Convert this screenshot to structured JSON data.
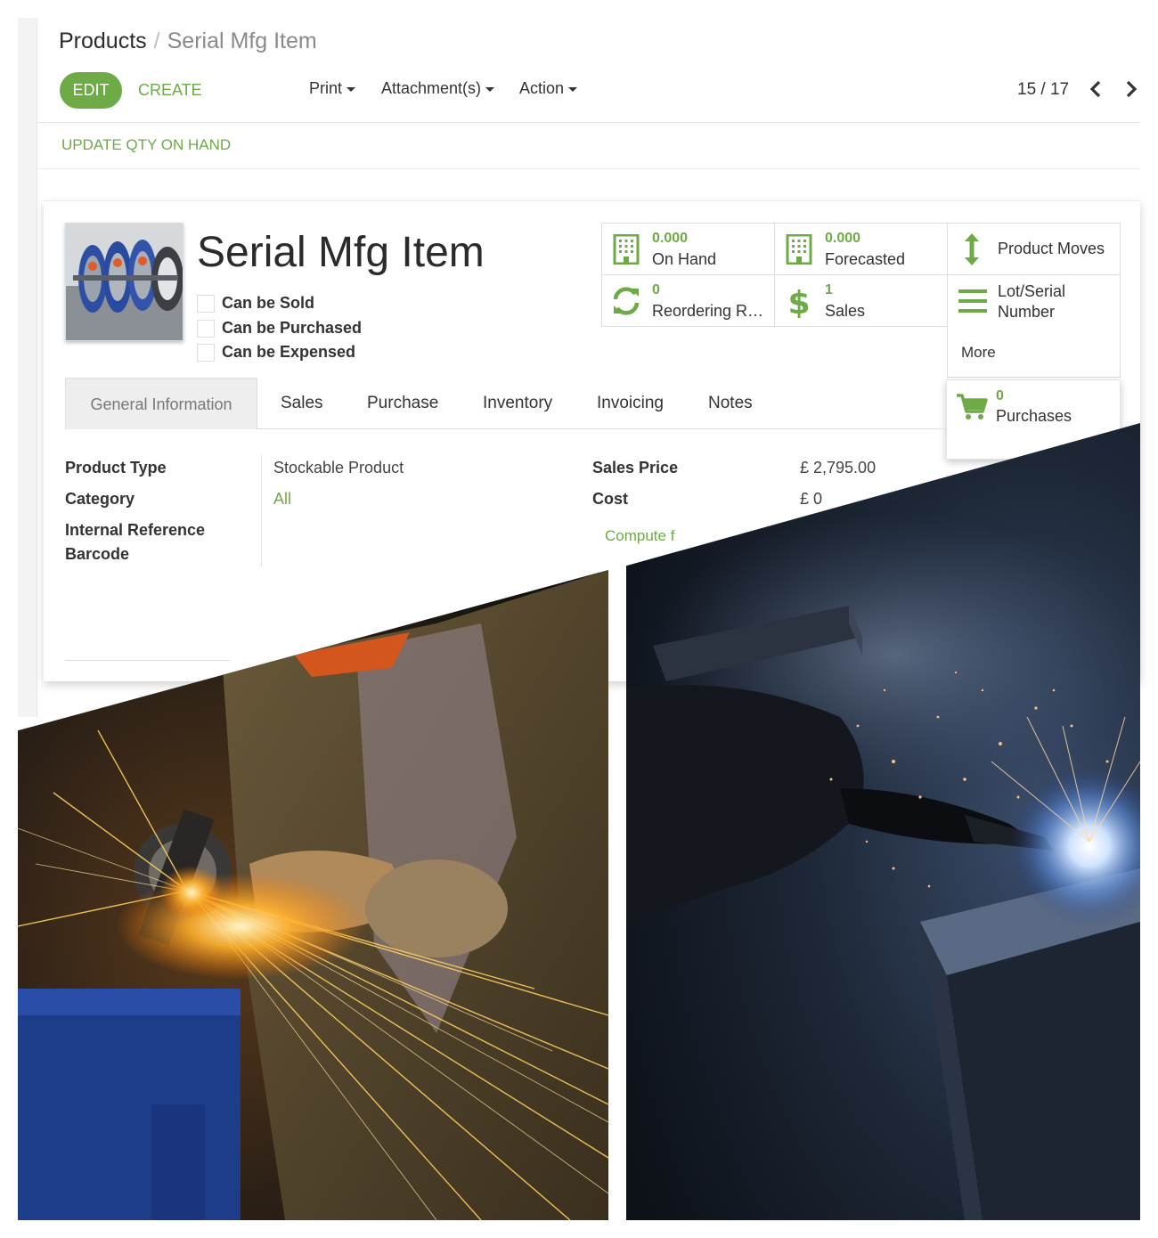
{
  "breadcrumb": {
    "root": "Products",
    "separator": "/",
    "current": "Serial Mfg Item"
  },
  "toolbar": {
    "edit_label": "EDIT",
    "create_label": "CREATE",
    "print_label": "Print",
    "attachments_label": "Attachment(s)",
    "action_label": "Action",
    "pager": "15 / 17"
  },
  "status": {
    "update_qty_label": "UPDATE QTY ON HAND"
  },
  "product": {
    "name": "Serial Mfg Item",
    "checks": [
      {
        "label": "Can be Sold",
        "checked": false
      },
      {
        "label": "Can be Purchased",
        "checked": false
      },
      {
        "label": "Can be Expensed",
        "checked": false
      }
    ]
  },
  "smart_buttons": {
    "on_hand": {
      "value": "0.000",
      "label": "On Hand",
      "icon": "building-icon"
    },
    "forecasted": {
      "value": "0.000",
      "label": "Forecasted",
      "icon": "building-icon"
    },
    "product_moves": {
      "label": "Product Moves",
      "icon": "up-down-arrow-icon"
    },
    "reordering": {
      "value": "0",
      "label": "Reordering R…",
      "icon": "refresh-icon"
    },
    "sales": {
      "value": "1",
      "label": "Sales",
      "icon": "dollar-icon"
    },
    "lot_serial": {
      "label_line1": "Lot/Serial",
      "label_line2": "Number",
      "icon": "list-icon"
    },
    "more_label": "More",
    "purchases": {
      "value": "0",
      "label": "Purchases",
      "icon": "cart-icon"
    }
  },
  "tabs": [
    "General Information",
    "Sales",
    "Purchase",
    "Inventory",
    "Invoicing",
    "Notes"
  ],
  "general": {
    "product_type_label": "Product Type",
    "product_type_value": "Stockable Product",
    "category_label": "Category",
    "category_value": "All",
    "internal_ref_label": "Internal Reference",
    "barcode_label": "Barcode",
    "sales_price_label": "Sales Price",
    "sales_price_value": "£ 2,795.00",
    "cost_label": "Cost",
    "cost_value": "£ 0",
    "compute_label": "Compute f"
  },
  "colors": {
    "accent": "#6eab47",
    "text": "#333333"
  }
}
